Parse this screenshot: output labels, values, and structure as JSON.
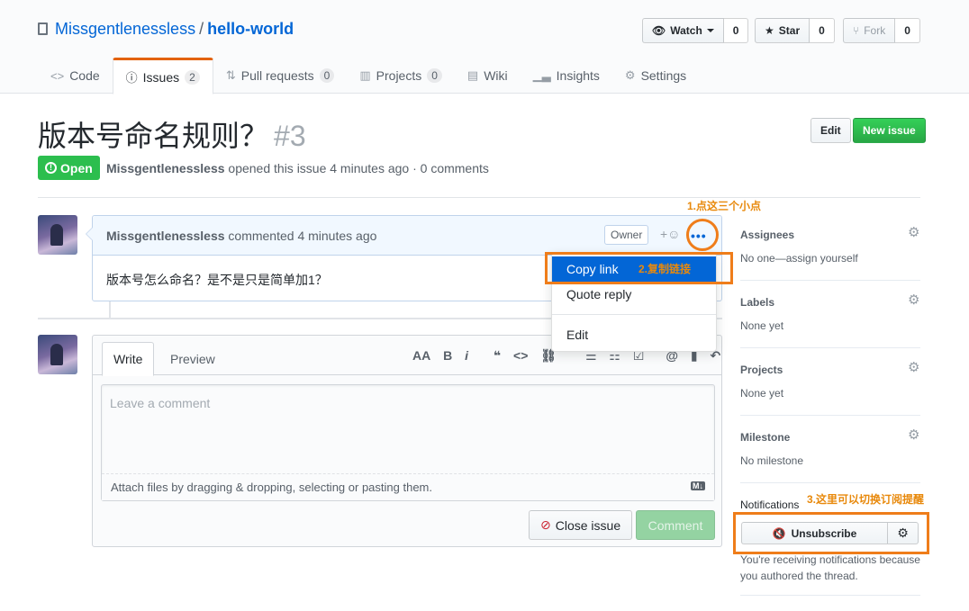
{
  "repo": {
    "owner": "Missgentlenessless",
    "separator": "/",
    "name": "hello-world"
  },
  "actions": {
    "watch": {
      "label": "Watch",
      "count": "0"
    },
    "star": {
      "label": "Star",
      "count": "0"
    },
    "fork": {
      "label": "Fork",
      "count": "0"
    }
  },
  "tabs": [
    {
      "label": "Code",
      "icon": "code-icon"
    },
    {
      "label": "Issues",
      "count": "2",
      "icon": "issue-opened-icon"
    },
    {
      "label": "Pull requests",
      "count": "0",
      "icon": "pull-request-icon"
    },
    {
      "label": "Projects",
      "count": "0",
      "icon": "project-icon"
    },
    {
      "label": "Wiki",
      "icon": "book-icon"
    },
    {
      "label": "Insights",
      "icon": "graph-icon"
    },
    {
      "label": "Settings",
      "icon": "gear-icon"
    }
  ],
  "issue": {
    "title": "版本号命名规则？",
    "number": "#3",
    "state": "Open",
    "author": "Missgentlenessless",
    "meta_text": "opened this issue 4 minutes ago · 0 comments",
    "edit_label": "Edit",
    "new_issue_label": "New issue"
  },
  "comment": {
    "author": "Missgentlenessless",
    "time": "commented 4 minutes ago",
    "owner_label": "Owner",
    "reaction": "+☺",
    "more": "•••",
    "body": "版本号怎么命名？是不是只是简单加1？"
  },
  "dropdown": {
    "items": [
      "Copy link",
      "Quote reply",
      "Edit"
    ]
  },
  "form": {
    "tab_write": "Write",
    "tab_preview": "Preview",
    "toolbar": [
      "AA",
      "B",
      "i",
      "❝",
      "<>",
      "⛓",
      "☰",
      "☷",
      "☑",
      "@",
      "▮",
      "↶"
    ],
    "placeholder": "Leave a comment",
    "attach_text": "Attach files by dragging & dropping, selecting or pasting them.",
    "markdown_badge": "M↓",
    "close_issue": "Close issue",
    "comment_button": "Comment"
  },
  "sidebar": {
    "assignees": {
      "heading": "Assignees",
      "value": "No one—assign yourself"
    },
    "labels": {
      "heading": "Labels",
      "value": "None yet"
    },
    "projects": {
      "heading": "Projects",
      "value": "None yet"
    },
    "milestone": {
      "heading": "Milestone",
      "value": "No milestone"
    },
    "notifications": {
      "heading": "Notifications",
      "button": "Unsubscribe",
      "note": "You're receiving notifications because you authored the thread."
    }
  },
  "annotations": {
    "step1": "1.点这三个小点",
    "step2": "2.复制链接",
    "step3": "3.这里可以切换订阅提醒"
  },
  "colors": {
    "link": "#0366d6",
    "open_green": "#2cbe4e",
    "annotation_orange": "#ef7d1a",
    "highlight_blue": "#0366d6"
  }
}
